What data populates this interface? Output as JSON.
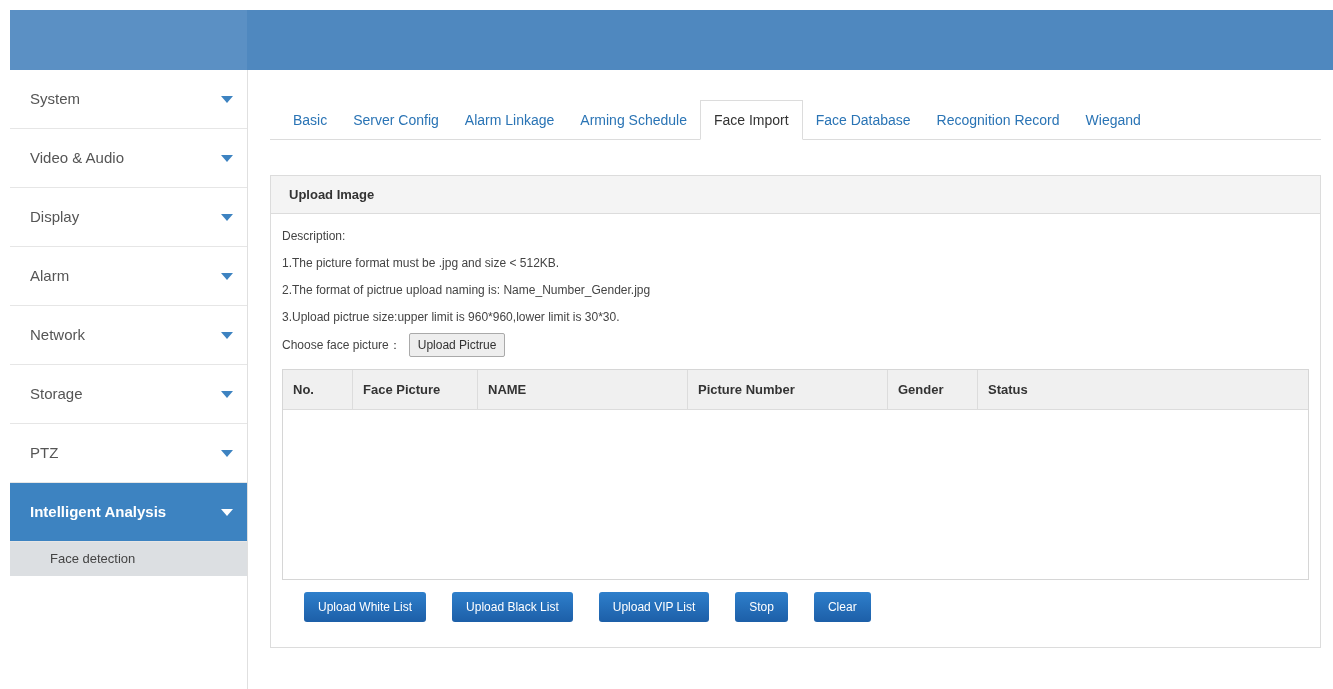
{
  "sidebar": {
    "items": [
      {
        "label": "System",
        "selected": false
      },
      {
        "label": "Video & Audio",
        "selected": false
      },
      {
        "label": "Display",
        "selected": false
      },
      {
        "label": "Alarm",
        "selected": false
      },
      {
        "label": "Network",
        "selected": false
      },
      {
        "label": "Storage",
        "selected": false
      },
      {
        "label": "PTZ",
        "selected": false
      },
      {
        "label": "Intelligent Analysis",
        "selected": true,
        "children": [
          {
            "label": "Face detection"
          }
        ]
      }
    ]
  },
  "tabs": [
    {
      "label": "Basic",
      "selected": false
    },
    {
      "label": "Server Config",
      "selected": false
    },
    {
      "label": "Alarm Linkage",
      "selected": false
    },
    {
      "label": "Arming Schedule",
      "selected": false
    },
    {
      "label": "Face Import",
      "selected": true
    },
    {
      "label": "Face Database",
      "selected": false
    },
    {
      "label": "Recognition Record",
      "selected": false
    },
    {
      "label": "Wiegand",
      "selected": false
    }
  ],
  "panel": {
    "title": "Upload Image",
    "description": [
      "Description:",
      "1.The picture format must be .jpg and size < 512KB.",
      "2.The format of pictrue upload naming is: Name_Number_Gender.jpg",
      "3.Upload pictrue size:upper limit is 960*960,lower limit is 30*30."
    ],
    "choose_label": "Choose face picture：",
    "choose_button": "Upload Pictrue",
    "table": {
      "columns": [
        "No.",
        "Face Picture",
        "NAME",
        "Picture Number",
        "Gender",
        "Status"
      ]
    },
    "buttons": [
      "Upload White List",
      "Upload Black List",
      "Upload VIP List",
      "Stop",
      "Clear"
    ]
  }
}
